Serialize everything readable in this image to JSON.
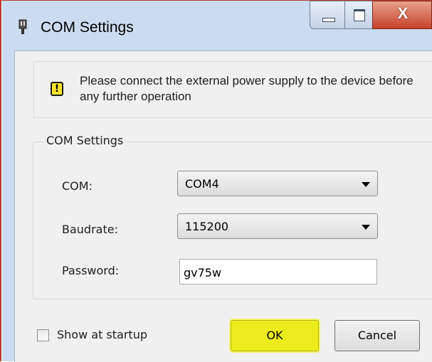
{
  "window": {
    "title": "COM Settings",
    "close_glyph": "X"
  },
  "notice": {
    "icon_glyph": "!",
    "text": "Please connect the external power supply to the device before any further operation"
  },
  "com_group": {
    "legend": "COM Settings",
    "com": {
      "label": "COM:",
      "value": "COM4"
    },
    "baudrate": {
      "label": "Baudrate:",
      "value": "115200"
    },
    "password": {
      "label": "Password:",
      "value": "gv75w"
    }
  },
  "footer": {
    "show_at_startup_label": "Show at startup",
    "show_at_startup_checked": false,
    "ok_label": "OK",
    "cancel_label": "Cancel"
  },
  "colors": {
    "ok_highlight": "#ecec1c",
    "close_button": "#c7422b",
    "window_frame": "#cbdcf0"
  },
  "icons": {
    "app": "connector-icon",
    "notice": "warning-icon",
    "dropdown": "chevron-down-icon"
  }
}
